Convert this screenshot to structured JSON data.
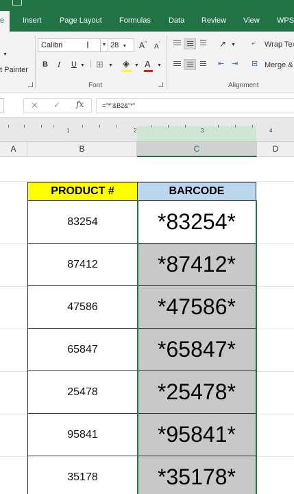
{
  "ribbon": {
    "tabs": [
      {
        "label": "e"
      },
      {
        "label": "Insert"
      },
      {
        "label": "Page Layout"
      },
      {
        "label": "Formulas"
      },
      {
        "label": "Data"
      },
      {
        "label": "Review"
      },
      {
        "label": "View"
      },
      {
        "label": "WPS"
      }
    ],
    "format_painter_label": "t Painter",
    "font_name": "Calibri",
    "font_size": "28",
    "font_group_label": "Font",
    "alignment_group_label": "Alignment",
    "wrap_text_label": "Wrap Tex",
    "merge_label": "Merge &",
    "bold_label": "B",
    "italic_label": "I",
    "underline_label": "U",
    "grow_font_label": "A",
    "shrink_font_label": "A",
    "font_color_label": "A"
  },
  "formula_bar": {
    "formula": "=\"*\"&B2&\"*\""
  },
  "ruler": {
    "marks": [
      "1",
      "2",
      "3",
      "4"
    ]
  },
  "columns": [
    {
      "letter": "A"
    },
    {
      "letter": "B"
    },
    {
      "letter": "C"
    },
    {
      "letter": "D"
    }
  ],
  "table": {
    "headers": {
      "product": "PRODUCT #",
      "barcode": "BARCODE"
    },
    "rows": [
      {
        "product": "83254",
        "barcode": "*83254*"
      },
      {
        "product": "87412",
        "barcode": "*87412*"
      },
      {
        "product": "47586",
        "barcode": "*47586*"
      },
      {
        "product": "65847",
        "barcode": "*65847*"
      },
      {
        "product": "25478",
        "barcode": "*25478*"
      },
      {
        "product": "95841",
        "barcode": "*95841*"
      },
      {
        "product": "35178",
        "barcode": "*35178*"
      }
    ]
  },
  "colors": {
    "ribbon_green": "#217346",
    "header_yellow": "#ffff00",
    "header_blue": "#bdd7ee",
    "selected_gray": "#c8c8c8"
  }
}
